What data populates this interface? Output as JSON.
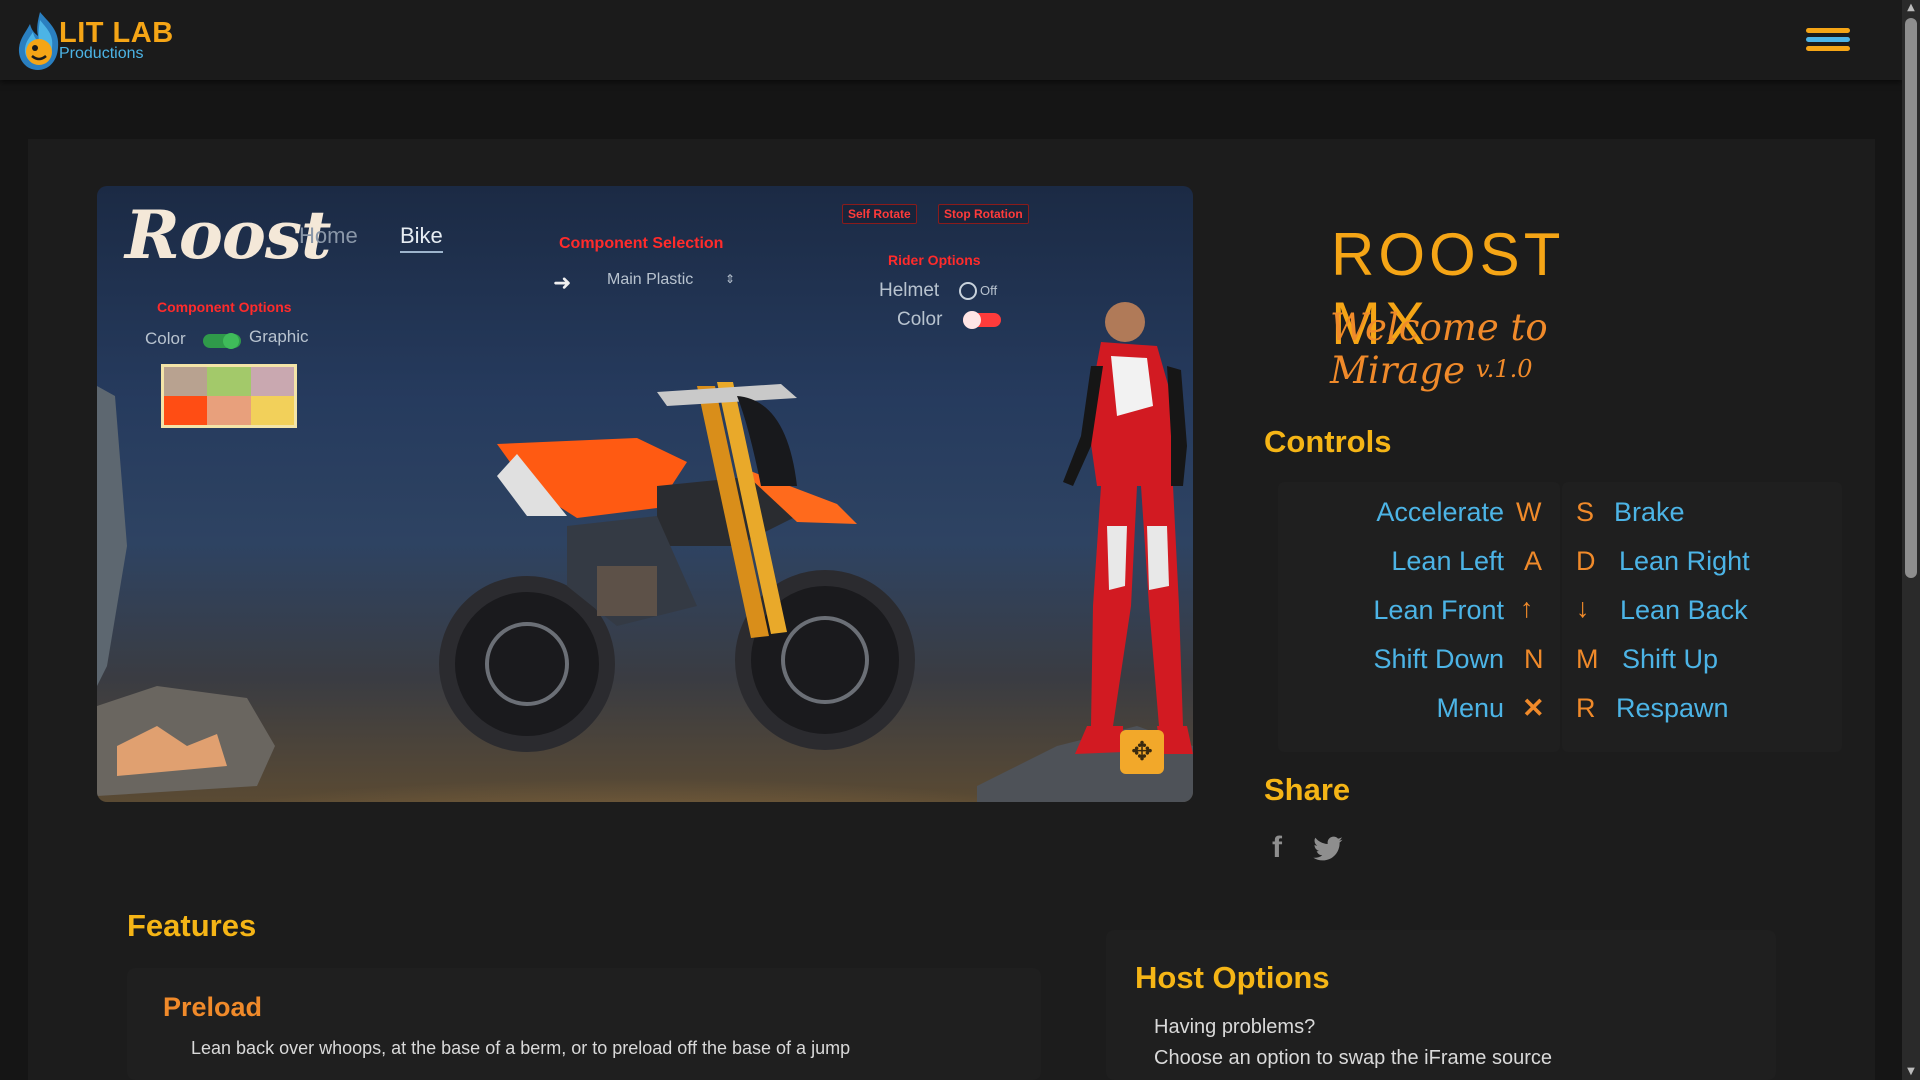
{
  "header": {
    "brand_title": "LIT LAB",
    "brand_subtitle": "Productions",
    "menu_icon": "hamburger-menu-icon",
    "colors": {
      "orange": "#f5a516",
      "blue": "#4cb4e6"
    }
  },
  "game": {
    "brand": "Roost",
    "nav": {
      "home": "Home",
      "bike": "Bike"
    },
    "component_options": {
      "title": "Component Options",
      "color_label": "Color",
      "graphic_label": "Graphic",
      "swatches": [
        "#b8a290",
        "#a3c96a",
        "#c9a8b0",
        "#ff4d14",
        "#e8a07c",
        "#f2d05a"
      ]
    },
    "component_selection": {
      "title": "Component Selection",
      "value": "Main Plastic"
    },
    "buttons": {
      "self_rotate": "Self Rotate",
      "stop_rotation": "Stop Rotation"
    },
    "rider_options": {
      "title": "Rider Options",
      "helmet_label": "Helmet",
      "helmet_value": "Off",
      "color_label": "Color"
    },
    "move_icon": "move-arrows-icon"
  },
  "info": {
    "title": "ROOST MX",
    "tagline": "Welcome to Mirage",
    "version": "v.1.0"
  },
  "controls": {
    "heading": "Controls",
    "left": [
      {
        "action": "Accelerate",
        "key": "W"
      },
      {
        "action": "Lean Left",
        "key": "A"
      },
      {
        "action": "Lean Front",
        "key": "↑"
      },
      {
        "action": "Shift Down",
        "key": "N"
      },
      {
        "action": "Menu",
        "key": "✕"
      }
    ],
    "right": [
      {
        "key": "S",
        "action": "Brake"
      },
      {
        "key": "D",
        "action": "Lean Right"
      },
      {
        "key": "↓",
        "action": "Lean Back"
      },
      {
        "key": "M",
        "action": "Shift Up"
      },
      {
        "key": "R",
        "action": "Respawn"
      }
    ]
  },
  "share": {
    "heading": "Share",
    "icons": [
      "facebook-icon",
      "twitter-icon"
    ]
  },
  "features": {
    "heading": "Features",
    "item_title": "Preload",
    "item_text": "Lean back over whoops, at the base of a berm, or to preload off the base of a jump"
  },
  "host_options": {
    "heading": "Host Options",
    "line1": "Having problems?",
    "line2": "Choose an option to swap the iFrame source"
  }
}
